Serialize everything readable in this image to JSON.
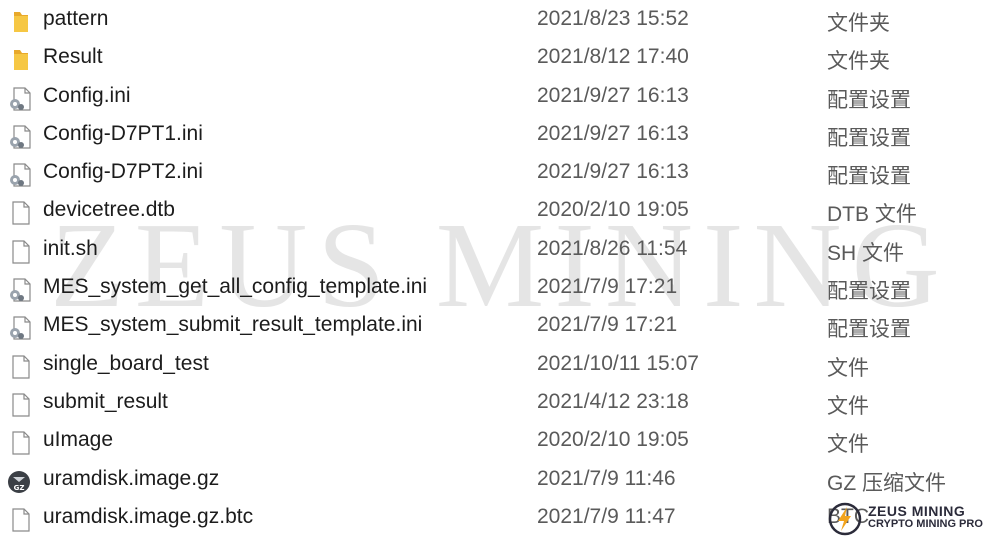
{
  "files": [
    {
      "name": "pattern",
      "modified": "2021/8/23 15:52",
      "type": "文件夹",
      "icon": "folder-icon"
    },
    {
      "name": "Result",
      "modified": "2021/8/12 17:40",
      "type": "文件夹",
      "icon": "folder-icon"
    },
    {
      "name": "Config.ini",
      "modified": "2021/9/27 16:13",
      "type": "配置设置",
      "icon": "settings-file-icon"
    },
    {
      "name": "Config-D7PT1.ini",
      "modified": "2021/9/27 16:13",
      "type": "配置设置",
      "icon": "settings-file-icon"
    },
    {
      "name": "Config-D7PT2.ini",
      "modified": "2021/9/27 16:13",
      "type": "配置设置",
      "icon": "settings-file-icon"
    },
    {
      "name": "devicetree.dtb",
      "modified": "2020/2/10 19:05",
      "type": "DTB 文件",
      "icon": "file-icon"
    },
    {
      "name": "init.sh",
      "modified": "2021/8/26 11:54",
      "type": "SH 文件",
      "icon": "file-icon"
    },
    {
      "name": "MES_system_get_all_config_template.ini",
      "modified": "2021/7/9 17:21",
      "type": "配置设置",
      "icon": "settings-file-icon"
    },
    {
      "name": "MES_system_submit_result_template.ini",
      "modified": "2021/7/9 17:21",
      "type": "配置设置",
      "icon": "settings-file-icon"
    },
    {
      "name": "single_board_test",
      "modified": "2021/10/11 15:07",
      "type": "文件",
      "icon": "file-icon"
    },
    {
      "name": "submit_result",
      "modified": "2021/4/12 23:18",
      "type": "文件",
      "icon": "file-icon"
    },
    {
      "name": "uImage",
      "modified": "2020/2/10 19:05",
      "type": "文件",
      "icon": "file-icon"
    },
    {
      "name": "uramdisk.image.gz",
      "modified": "2021/7/9 11:46",
      "type": "GZ 压缩文件",
      "icon": "gz-archive-icon"
    },
    {
      "name": "uramdisk.image.gz.btc",
      "modified": "2021/7/9 11:47",
      "type": "BTC",
      "icon": "file-icon"
    }
  ],
  "watermark": "ZEUS MINING",
  "brand": {
    "line1": "ZEUS MINING",
    "line2": "CRYPTO MINING PRO"
  },
  "colors": {
    "folder": "#f4c13d",
    "text_primary": "#1c1c1c",
    "text_secondary": "#5a5a5a",
    "brand_accent": "#f2a31b"
  }
}
